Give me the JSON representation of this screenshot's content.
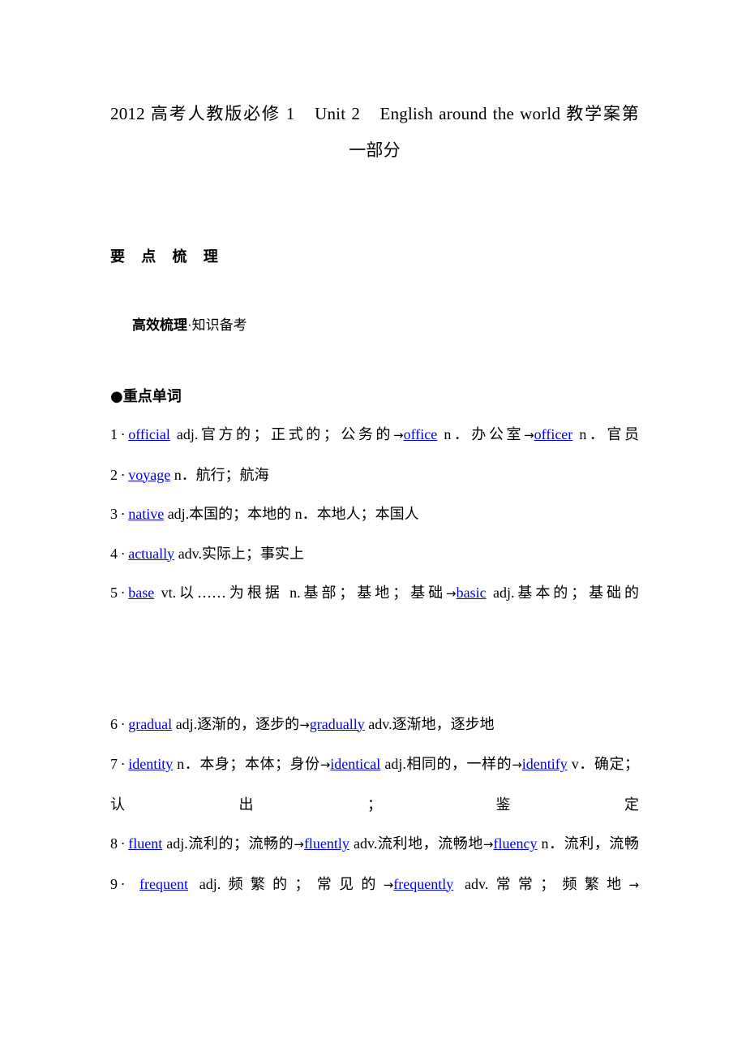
{
  "document": {
    "title_line1": "2012 高考人教版必修 1　Unit 2　English around the world 教学案第",
    "title_line2": "一部分"
  },
  "sections": {
    "main_heading": "要 点 梳 理",
    "sub_heading_strong": "高效梳理",
    "sub_heading_rest": "·知识备考",
    "bullet_heading": "●重点单词"
  },
  "vocabulary": {
    "group1": [
      {
        "num": "1",
        "sep": "·",
        "parts": [
          {
            "type": "link",
            "text": "official"
          },
          {
            "type": "plain",
            "text": " adj.官方的；正式的；公务的"
          },
          {
            "type": "arrow",
            "text": "→"
          },
          {
            "type": "link",
            "text": "office"
          },
          {
            "type": "plain",
            "text": " n．办公室"
          },
          {
            "type": "arrow",
            "text": "→"
          },
          {
            "type": "link",
            "text": "officer"
          },
          {
            "type": "plain",
            "text": " n．官员"
          }
        ]
      },
      {
        "num": "2",
        "sep": "·",
        "parts": [
          {
            "type": "link",
            "text": "voyage"
          },
          {
            "type": "plain",
            "text": " n．航行；航海"
          }
        ]
      },
      {
        "num": "3",
        "sep": "·",
        "parts": [
          {
            "type": "link",
            "text": "native"
          },
          {
            "type": "plain",
            "text": " adj.本国的；本地的 n．本地人；本国人"
          }
        ]
      },
      {
        "num": "4",
        "sep": "·",
        "parts": [
          {
            "type": "link",
            "text": "actually"
          },
          {
            "type": "plain",
            "text": " adv.实际上；事实上"
          }
        ]
      },
      {
        "num": "5",
        "sep": "·",
        "parts": [
          {
            "type": "link",
            "text": "base"
          },
          {
            "type": "plain",
            "text": " vt.以……为根据 n.基部；基地；基础"
          },
          {
            "type": "arrow",
            "text": "→"
          },
          {
            "type": "link",
            "text": "basic"
          },
          {
            "type": "plain",
            "text": " adj.基本的；基础的"
          }
        ]
      }
    ],
    "group2": [
      {
        "num": "6",
        "sep": "·",
        "parts": [
          {
            "type": "link",
            "text": "gradual"
          },
          {
            "type": "plain",
            "text": " adj.逐渐的，逐步的"
          },
          {
            "type": "arrow",
            "text": "→"
          },
          {
            "type": "link",
            "text": "gradually"
          },
          {
            "type": "plain",
            "text": " adv.逐渐地，逐步地"
          }
        ]
      },
      {
        "num": "7",
        "sep": "·",
        "parts": [
          {
            "type": "link",
            "text": "identity"
          },
          {
            "type": "plain",
            "text": " n．本身；本体；身份"
          },
          {
            "type": "arrow",
            "text": "→"
          },
          {
            "type": "link",
            "text": "identical"
          },
          {
            "type": "plain",
            "text": " adj.相同的，一样的"
          },
          {
            "type": "arrow",
            "text": "→"
          },
          {
            "type": "link",
            "text": "identify"
          },
          {
            "type": "plain",
            "text": " v．确定；认出；鉴定"
          }
        ]
      },
      {
        "num": "8",
        "sep": "·",
        "parts": [
          {
            "type": "link",
            "text": "fluent"
          },
          {
            "type": "plain",
            "text": " adj.流利的；流畅的"
          },
          {
            "type": "arrow",
            "text": "→"
          },
          {
            "type": "link",
            "text": "fluently"
          },
          {
            "type": "plain",
            "text": " adv.流利地，流畅地"
          },
          {
            "type": "arrow",
            "text": "→"
          },
          {
            "type": "link",
            "text": "fluency"
          },
          {
            "type": "plain",
            "text": " n．流利，流畅"
          }
        ]
      },
      {
        "num": "9",
        "sep": "·",
        "parts": [
          {
            "type": "plain",
            "text": " "
          },
          {
            "type": "link",
            "text": "frequent"
          },
          {
            "type": "plain",
            "text": " adj.频繁的；常见的"
          },
          {
            "type": "arrow",
            "text": "→"
          },
          {
            "type": "link",
            "text": "frequently"
          },
          {
            "type": "plain",
            "text": " adv.常常；频繁地"
          },
          {
            "type": "arrow",
            "text": "→"
          }
        ]
      }
    ]
  },
  "colors": {
    "link": "#0000ee",
    "text": "#000000",
    "background": "#ffffff"
  }
}
